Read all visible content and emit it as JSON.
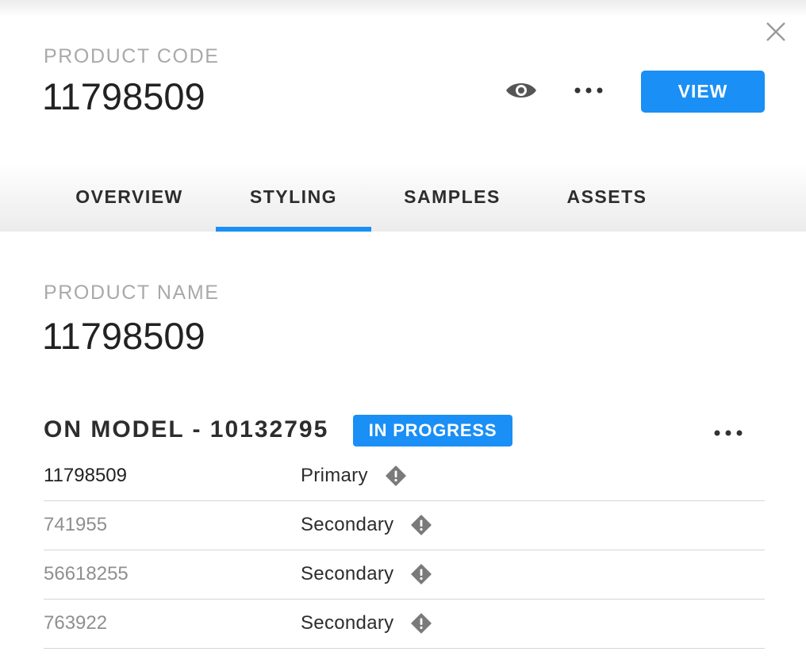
{
  "header": {
    "code_label": "PRODUCT CODE",
    "code_value": "11798509",
    "view_button_label": "VIEW"
  },
  "tabs": [
    {
      "label": "OVERVIEW",
      "active": false
    },
    {
      "label": "STYLING",
      "active": true
    },
    {
      "label": "SAMPLES",
      "active": false
    },
    {
      "label": "ASSETS",
      "active": false
    }
  ],
  "product": {
    "name_label": "PRODUCT NAME",
    "name_value": "11798509"
  },
  "section": {
    "title": "ON MODEL - 10132795",
    "status": "IN PROGRESS",
    "rows": [
      {
        "code": "11798509",
        "role": "Primary"
      },
      {
        "code": "741955",
        "role": "Secondary"
      },
      {
        "code": "56618255",
        "role": "Secondary"
      },
      {
        "code": "763922",
        "role": "Secondary"
      }
    ]
  },
  "colors": {
    "accent": "#1a8ff5",
    "muted_label": "#a9a9a9",
    "text": "#222222"
  },
  "icons": {
    "close": "close-icon",
    "eye": "eye-icon",
    "more": "more-horizontal-icon",
    "info": "info-diamond-icon"
  }
}
